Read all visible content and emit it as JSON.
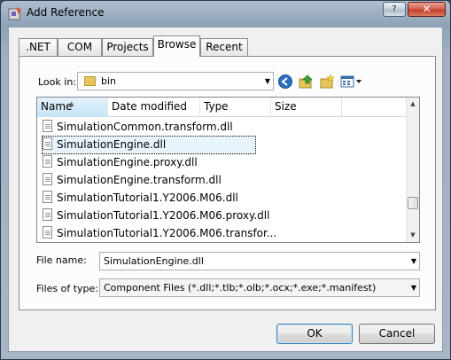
{
  "window": {
    "title": "Add Reference",
    "help_label": "?",
    "close_label": "✕"
  },
  "tabs": [
    {
      "label": ".NET"
    },
    {
      "label": "COM"
    },
    {
      "label": "Projects"
    },
    {
      "label": "Browse",
      "active": true
    },
    {
      "label": "Recent"
    }
  ],
  "lookin": {
    "label": "Look in:",
    "value": "bin"
  },
  "nav_icons": [
    "back-icon",
    "up-folder-icon",
    "new-folder-icon",
    "view-menu-icon"
  ],
  "list": {
    "columns": [
      "Name",
      "Date modified",
      "Type",
      "Size"
    ],
    "sorted_column": "Name",
    "files": [
      "SimulationCommon.transform.dll",
      "SimulationEngine.dll",
      "SimulationEngine.proxy.dll",
      "SimulationEngine.transform.dll",
      "SimulationTutorial1.Y2006.M06.dll",
      "SimulationTutorial1.Y2006.M06.proxy.dll",
      "SimulationTutorial1.Y2006.M06.transfor..."
    ],
    "selected_index": 1
  },
  "filename": {
    "label": "File name:",
    "value": "SimulationEngine.dll"
  },
  "filetype": {
    "label": "Files of type:",
    "value": "Component Files (*.dll;*.tlb;*.olb;*.ocx;*.exe;*.manifest)"
  },
  "buttons": {
    "ok": "OK",
    "cancel": "Cancel"
  },
  "colors": {
    "title_bar": "#8ea3b8",
    "close_button": "#c23a22",
    "selection": "#e8f4fc"
  }
}
